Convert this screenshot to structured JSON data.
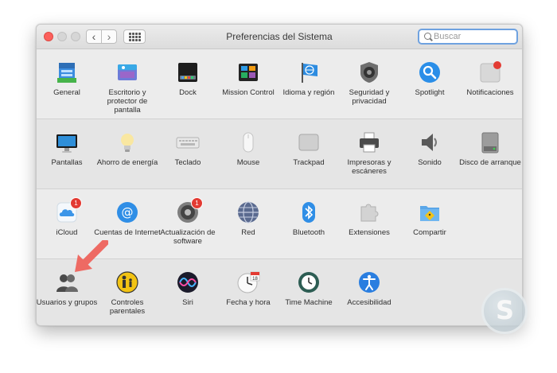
{
  "window": {
    "title": "Preferencias del Sistema",
    "search_placeholder": "Buscar"
  },
  "rows": [
    [
      {
        "label": "General",
        "icon": "general-icon"
      },
      {
        "label": "Escritorio y protector de pantalla",
        "icon": "desktop-screensaver-icon"
      },
      {
        "label": "Dock",
        "icon": "dock-icon"
      },
      {
        "label": "Mission Control",
        "icon": "mission-control-icon"
      },
      {
        "label": "Idioma y región",
        "icon": "language-region-icon"
      },
      {
        "label": "Seguridad y privacidad",
        "icon": "security-privacy-icon"
      },
      {
        "label": "Spotlight",
        "icon": "spotlight-icon"
      },
      {
        "label": "Notificaciones",
        "icon": "notifications-icon"
      }
    ],
    [
      {
        "label": "Pantallas",
        "icon": "displays-icon"
      },
      {
        "label": "Ahorro de energía",
        "icon": "energy-saver-icon"
      },
      {
        "label": "Teclado",
        "icon": "keyboard-icon"
      },
      {
        "label": "Mouse",
        "icon": "mouse-icon"
      },
      {
        "label": "Trackpad",
        "icon": "trackpad-icon"
      },
      {
        "label": "Impresoras y escáneres",
        "icon": "printers-icon"
      },
      {
        "label": "Sonido",
        "icon": "sound-icon"
      },
      {
        "label": "Disco de arranque",
        "icon": "startup-disk-icon"
      }
    ],
    [
      {
        "label": "iCloud",
        "icon": "icloud-icon",
        "badge": "1"
      },
      {
        "label": "Cuentas de Internet",
        "icon": "internet-accounts-icon"
      },
      {
        "label": "Actualización de software",
        "icon": "software-update-icon",
        "badge": "1"
      },
      {
        "label": "Red",
        "icon": "network-icon"
      },
      {
        "label": "Bluetooth",
        "icon": "bluetooth-icon"
      },
      {
        "label": "Extensiones",
        "icon": "extensions-icon"
      },
      {
        "label": "Compartir",
        "icon": "sharing-icon"
      }
    ],
    [
      {
        "label": "Usuarios y grupos",
        "icon": "users-groups-icon"
      },
      {
        "label": "Controles parentales",
        "icon": "parental-controls-icon"
      },
      {
        "label": "Siri",
        "icon": "siri-icon"
      },
      {
        "label": "Fecha y hora",
        "icon": "date-time-icon"
      },
      {
        "label": "Time Machine",
        "icon": "time-machine-icon"
      },
      {
        "label": "Accesibilidad",
        "icon": "accessibility-icon"
      }
    ]
  ],
  "calendar_day": "18",
  "colors": {
    "accent": "#1e86e6",
    "badge": "#e33b33",
    "arrow": "#ee6a63",
    "window_bg": "#ececec"
  }
}
